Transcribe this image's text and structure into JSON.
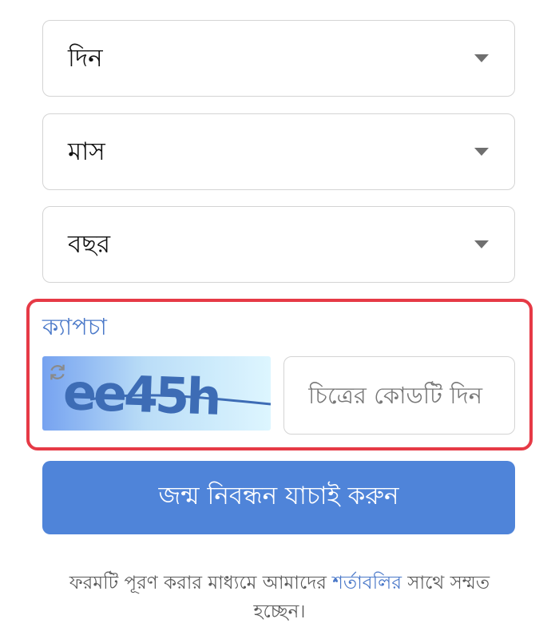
{
  "form": {
    "day_select": {
      "value": "দিন"
    },
    "month_select": {
      "value": "মাস"
    },
    "year_select": {
      "value": "বছর"
    },
    "captcha": {
      "label": "ক্যাপচা",
      "image_text": "ee45h",
      "refresh_icon": "refresh-icon",
      "input_placeholder": "চিত্রের কোডটি দিন",
      "input_value": "",
      "highlight_color": "#e63a46"
    },
    "submit_label": "জন্ম নিবন্ধন যাচাই করুন",
    "accent_color": "#4f84d9"
  },
  "terms": {
    "prefix": "ফরমটি পূরণ করার মাধ্যমে আমাদের ",
    "link": "শর্তাবলির",
    "suffix": " সাথে সম্মত হচ্ছেন।"
  }
}
